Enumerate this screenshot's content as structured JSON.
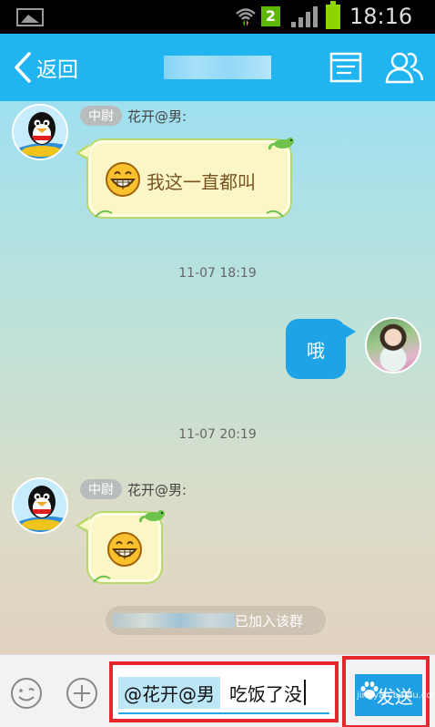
{
  "status_bar": {
    "sim_badge": "2",
    "clock": "18:16",
    "icons": [
      "gallery-icon",
      "wifi-icon",
      "signal-icon",
      "battery-icon"
    ]
  },
  "title_bar": {
    "back_label": "返回",
    "icons": [
      "chevron-left-icon",
      "profile-card-icon",
      "group-members-icon"
    ]
  },
  "messages": [
    {
      "type": "incoming",
      "rank": "中尉",
      "sender": "花开@男:",
      "emoji": "grin-icon",
      "text": "我这一直都叫"
    },
    {
      "type": "timestamp",
      "text": "11-07 18:19"
    },
    {
      "type": "outgoing",
      "text": "哦"
    },
    {
      "type": "timestamp",
      "text": "11-07 20:19"
    },
    {
      "type": "incoming",
      "rank": "中尉",
      "sender": "花开@男:",
      "emoji": "grin-icon",
      "text": ""
    },
    {
      "type": "system",
      "text": "已加入该群"
    }
  ],
  "input_bar": {
    "mention": "@花开@男",
    "typed_text": "吃饭了没",
    "send_label": "发送",
    "watermark": "jingyan.baidu.com",
    "icons": [
      "emoji-icon",
      "plus-icon",
      "baidu-paw-icon"
    ]
  },
  "colors": {
    "accent": "#20b5f0",
    "send_button": "#1e9fe6",
    "highlight_box": "#e8262d",
    "bubble_paper": "#fbf6c6"
  }
}
